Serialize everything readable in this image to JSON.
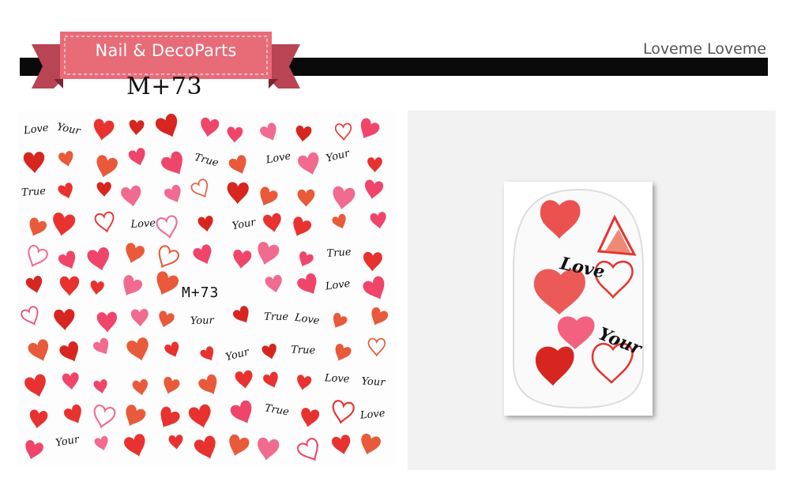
{
  "brand": {
    "tag_text": "Nail & DecoParts",
    "tag_color": "#e86b78",
    "tag_dark_color": "#b84454"
  },
  "product": {
    "sku": "M+73",
    "sheet_code": "M+73"
  },
  "shop": {
    "name": "Loveme Loveme"
  },
  "sticker_sheet": {
    "words": [
      "Love",
      "Your",
      "True"
    ],
    "heart_colors": [
      "#e8322f",
      "#f0456a",
      "#d7261f",
      "#e85a3a",
      "#f06b8f"
    ]
  },
  "preview": {
    "words": [
      "Love",
      "Your"
    ]
  }
}
